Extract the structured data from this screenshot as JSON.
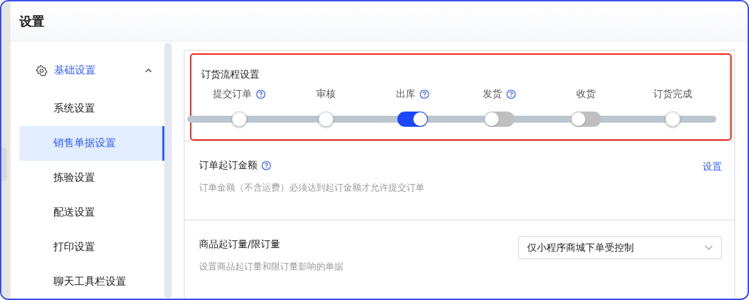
{
  "window": {
    "title": "设置"
  },
  "sidebar": {
    "group": {
      "label": "基础设置",
      "expanded": true
    },
    "items": [
      {
        "label": "系统设置",
        "selected": false
      },
      {
        "label": "销售单据设置",
        "selected": true
      },
      {
        "label": "拣验设置",
        "selected": false
      },
      {
        "label": "配送设置",
        "selected": false
      },
      {
        "label": "打印设置",
        "selected": false
      },
      {
        "label": "聊天工具栏设置",
        "selected": false
      }
    ]
  },
  "flow": {
    "title": "订货流程设置",
    "highlighted": true,
    "steps": [
      {
        "label": "提交订单",
        "help": true,
        "kind": "node"
      },
      {
        "label": "审核",
        "help": false,
        "kind": "node"
      },
      {
        "label": "出库",
        "help": true,
        "kind": "switch",
        "on": true
      },
      {
        "label": "发货",
        "help": true,
        "kind": "switch",
        "on": false
      },
      {
        "label": "收货",
        "help": false,
        "kind": "switch",
        "on": false
      },
      {
        "label": "订货完成",
        "help": false,
        "kind": "node"
      }
    ]
  },
  "settings": [
    {
      "title": "订单起订金额",
      "help": true,
      "description": "订单金额（不含运费）必须达到起订金额才允许提交订单",
      "control": {
        "kind": "link",
        "label": "设置"
      }
    },
    {
      "title": "商品起订量/限订量",
      "help": false,
      "description": "设置商品起订量和限订量影响的单据",
      "control": {
        "kind": "select",
        "value": "仅小程序商城下单受控制"
      }
    }
  ]
}
